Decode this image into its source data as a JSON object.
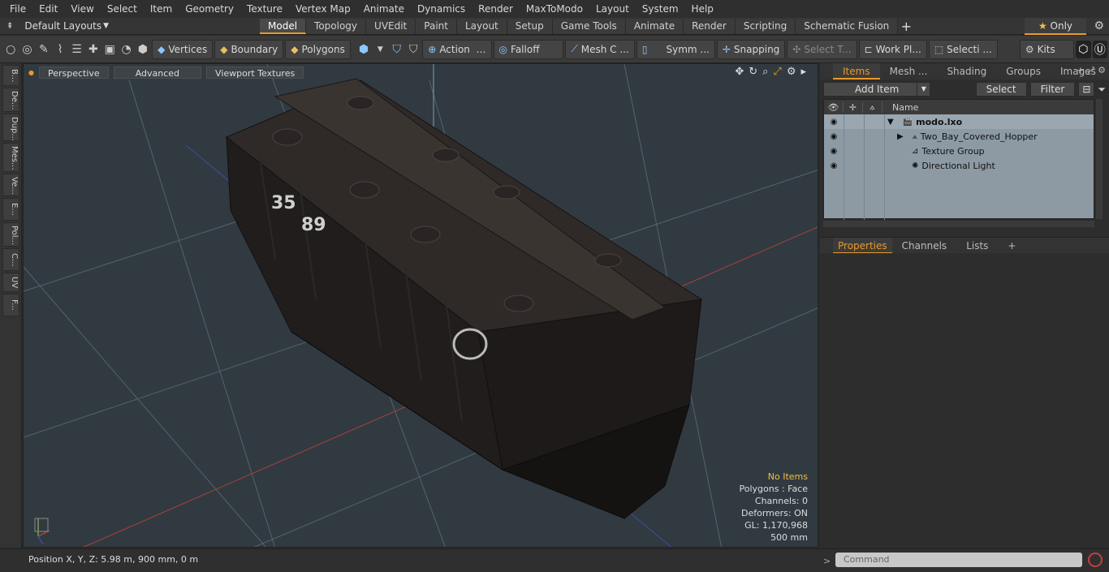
{
  "menu": [
    "File",
    "Edit",
    "View",
    "Select",
    "Item",
    "Geometry",
    "Texture",
    "Vertex Map",
    "Animate",
    "Dynamics",
    "Render",
    "MaxToModo",
    "Layout",
    "System",
    "Help"
  ],
  "layouts": {
    "label": "Default Layouts"
  },
  "tabs": [
    "Model",
    "Topology",
    "UVEdit",
    "Paint",
    "Layout",
    "Setup",
    "Game Tools",
    "Animate",
    "Render",
    "Scripting",
    "Schematic Fusion"
  ],
  "only_label": "Only",
  "toolbar": {
    "vertices": "Vertices",
    "boundary": "Boundary",
    "polygons": "Polygons",
    "action": "Action",
    "falloff": "Falloff",
    "mesh": "Mesh C ...",
    "symm": "Symm ...",
    "snapping": "Snapping",
    "select_t": "Select T...",
    "work_pl": "Work Pl...",
    "selecti": "Selecti ...",
    "kits": "Kits"
  },
  "left_strip": [
    "B...",
    "De...",
    "Dup...",
    "Mes...",
    "Ve...",
    "E...",
    "Pol...",
    "C...",
    "UV",
    "F..."
  ],
  "viewport": {
    "tabs": [
      "Perspective",
      "Advanced",
      "Viewport Textures"
    ],
    "info": {
      "no_items": "No Items",
      "polygons": "Polygons : Face",
      "channels": "Channels: 0",
      "deformers": "Deformers: ON",
      "gl": "GL: 1,170,968",
      "scale": "500 mm"
    },
    "car_number_a": "35",
    "car_number_b": "89"
  },
  "status": {
    "position": "Position X, Y, Z:   5.98 m, 900 mm, 0 m",
    "command_placeholder": "Command"
  },
  "items_panel": {
    "tabs": [
      "Items",
      "Mesh ...",
      "Shading",
      "Groups",
      "Images"
    ],
    "add_item": "Add Item",
    "select": "Select",
    "filter": "Filter",
    "name_col": "Name",
    "rows": [
      "modo.lxo",
      "Two_Bay_Covered_Hopper",
      "Texture Group",
      "Directional Light"
    ]
  },
  "props_panel": {
    "tabs": [
      "Properties",
      "Channels",
      "Lists"
    ]
  },
  "colors": {
    "accent": "#e89a2a",
    "viewport_bg": "#313a40",
    "tree_bg": "#8d9aa4"
  }
}
